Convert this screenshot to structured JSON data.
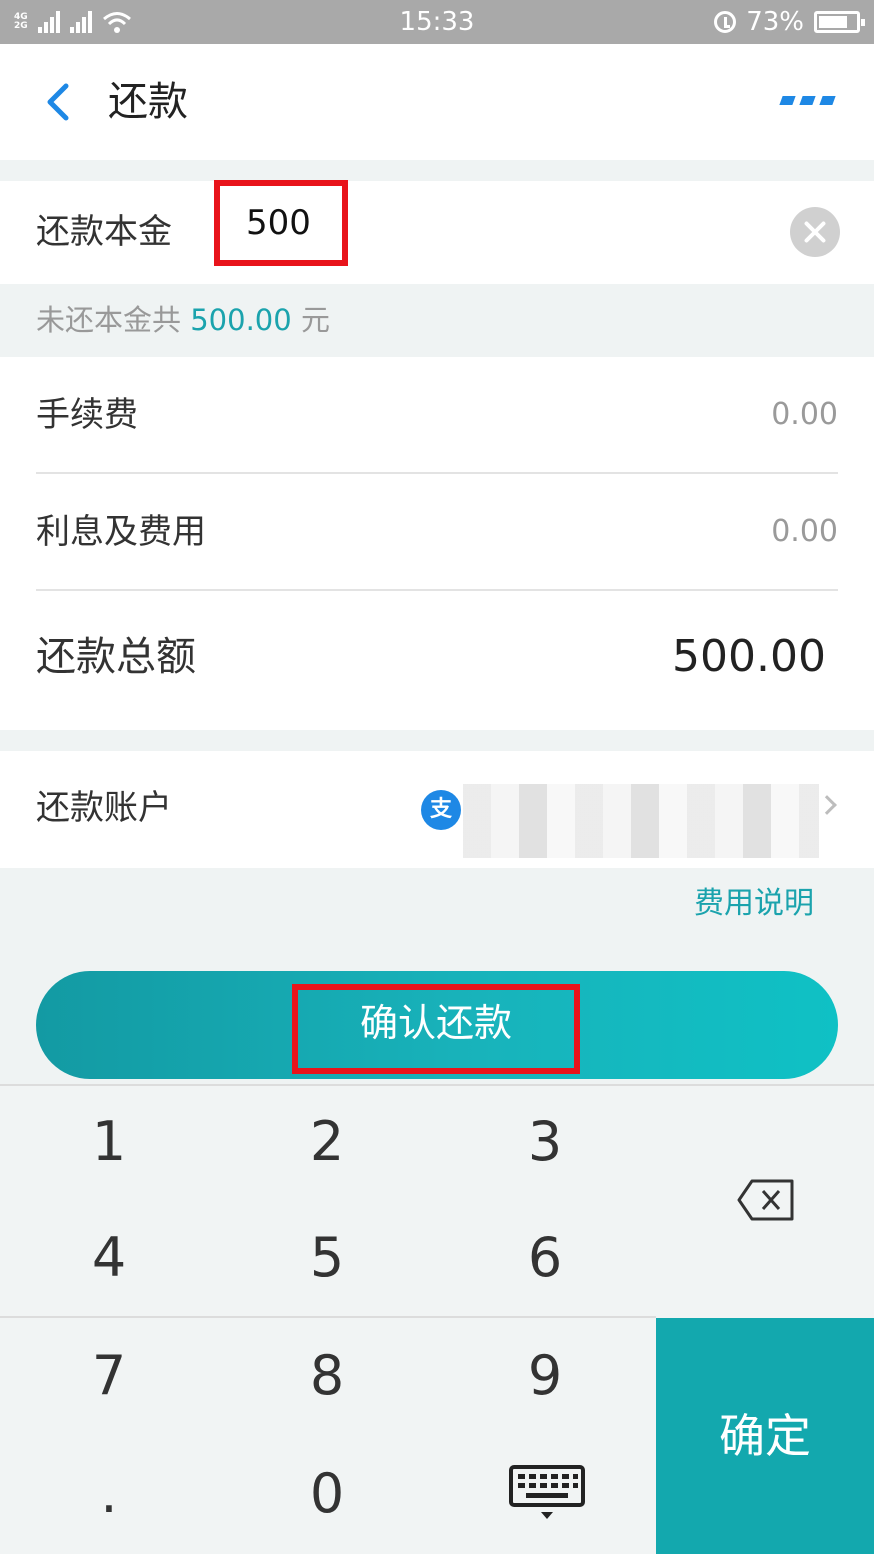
{
  "status_bar": {
    "network_a": "4G",
    "network_b": "2G",
    "time": "15:33",
    "battery": "73%"
  },
  "nav": {
    "title": "还款"
  },
  "principal": {
    "label": "还款本金",
    "value": "500"
  },
  "remain": {
    "prefix": "未还本金共",
    "amount": "500.00",
    "unit": "元"
  },
  "fees": {
    "handling_label": "手续费",
    "handling_value": "0.00",
    "interest_label": "利息及费用",
    "interest_value": "0.00",
    "total_label": "还款总额",
    "total_value": "500.00"
  },
  "account": {
    "label": "还款账户",
    "icon_text": "支"
  },
  "fee_link": "费用说明",
  "confirm_label": "确认还款",
  "keypad": {
    "keys": [
      "1",
      "2",
      "3",
      "4",
      "5",
      "6",
      "7",
      "8",
      "9",
      ".",
      "0"
    ],
    "ok_label": "确定"
  },
  "colors": {
    "accent": "#13a8ae",
    "highlight_box": "#e8141b",
    "link_blue": "#1e88e5"
  }
}
